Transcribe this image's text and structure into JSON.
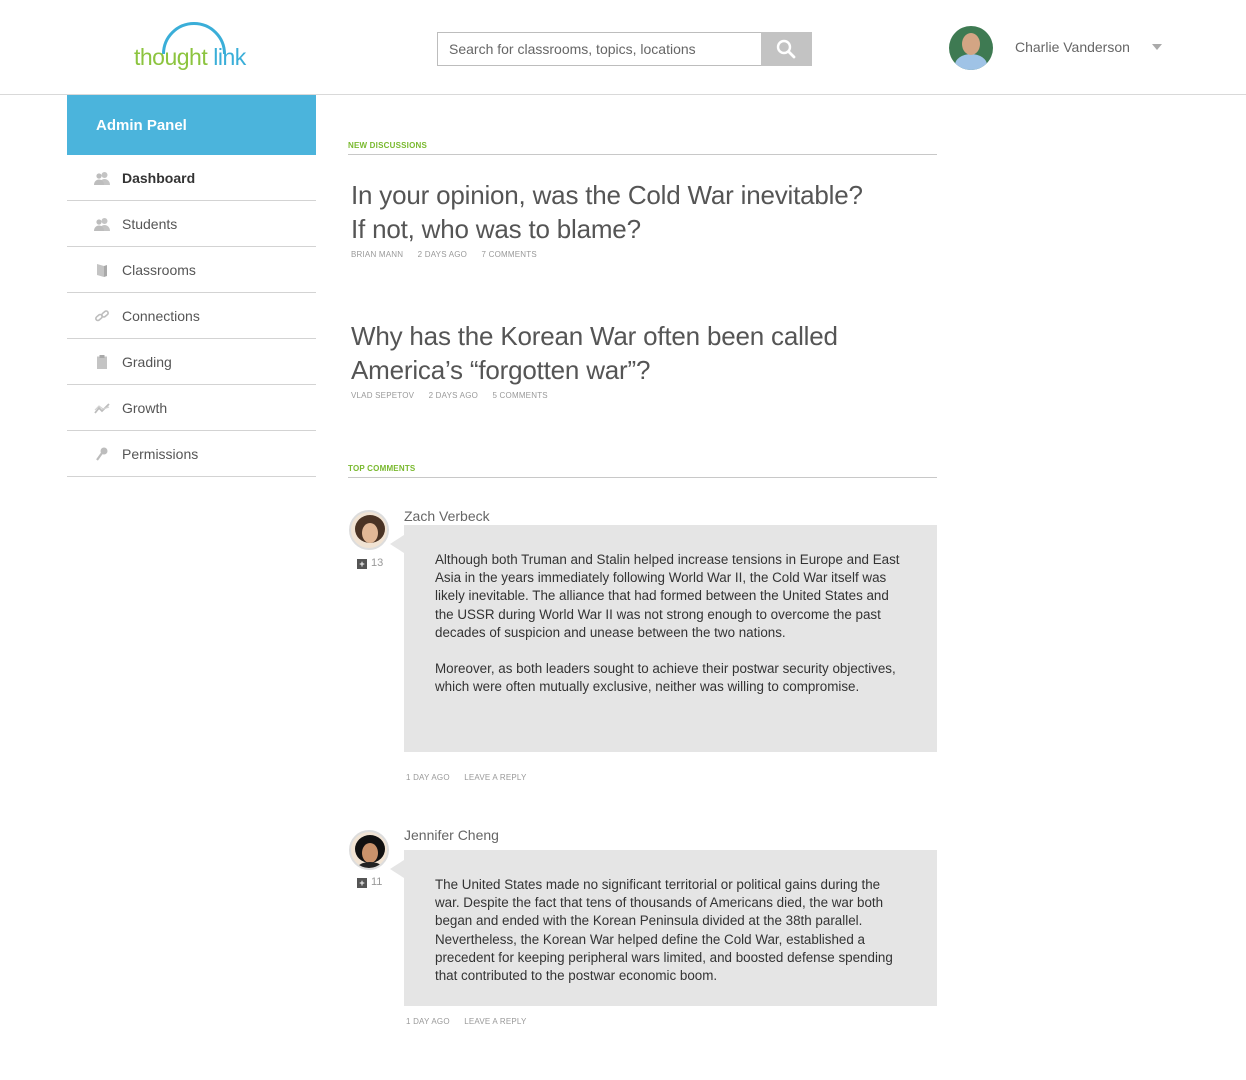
{
  "header": {
    "logo": {
      "part1": "thought",
      "part2": "link"
    },
    "search": {
      "placeholder": "Search for classrooms, topics, locations",
      "value": ""
    },
    "user": {
      "name": "Charlie Vanderson"
    }
  },
  "sidebar": {
    "title": "Admin Panel",
    "items": [
      {
        "label": "Dashboard",
        "icon": "users-icon",
        "active": true
      },
      {
        "label": "Students",
        "icon": "users-icon"
      },
      {
        "label": "Classrooms",
        "icon": "book-icon"
      },
      {
        "label": "Connections",
        "icon": "link-icon"
      },
      {
        "label": "Grading",
        "icon": "clipboard-icon"
      },
      {
        "label": "Growth",
        "icon": "chart-line-icon"
      },
      {
        "label": "Permissions",
        "icon": "key-icon"
      }
    ]
  },
  "main": {
    "new_discussions_label": "NEW DISCUSSIONS",
    "discussions": [
      {
        "title_line1": "In your opinion, was the Cold War inevitable?",
        "title_line2": "If not, who was to blame?",
        "author": "BRIAN MANN",
        "time": "2 DAYS AGO",
        "comments": "7 COMMENTS"
      },
      {
        "title_line1": "Why has the Korean War often been called",
        "title_line2": "America’s “forgotten war”?",
        "author": "VLAD SEPETOV",
        "time": "2 DAYS AGO",
        "comments": "5 COMMENTS"
      }
    ],
    "top_comments_label": "TOP COMMENTS",
    "comments": [
      {
        "author": "Zach Verbeck",
        "votes": "13",
        "paragraphs": [
          "Although both Truman and Stalin helped increase tensions in Europe and East Asia in the years immediately following World War II, the Cold War itself was likely inevitable. The alliance that had formed between the United States and the USSR during World War II was not strong enough to overcome the past decades of suspicion and unease between the two nations.",
          "Moreover, as both leaders sought to achieve their postwar security objectives, which were often mutually exclusive, neither was willing to compromise."
        ],
        "time": "1 DAY AGO",
        "reply": "LEAVE A REPLY"
      },
      {
        "author": "Jennifer Cheng",
        "votes": "11",
        "paragraphs": [
          "The United States made no significant territorial or political gains during the war. Despite the fact that tens of thousands of Americans died, the war both began and ended with the Korean Peninsula divided at the 38th parallel. Nevertheless, the Korean War helped define the Cold War, established a precedent for keeping peripheral wars limited, and boosted defense spending that contributed to the postwar economic boom."
        ],
        "time": "1 DAY AGO",
        "reply": "LEAVE A REPLY"
      }
    ]
  },
  "colors": {
    "accent_blue": "#4bb4dc",
    "accent_green": "#79b92e",
    "bubble_gray": "#e5e5e5"
  }
}
